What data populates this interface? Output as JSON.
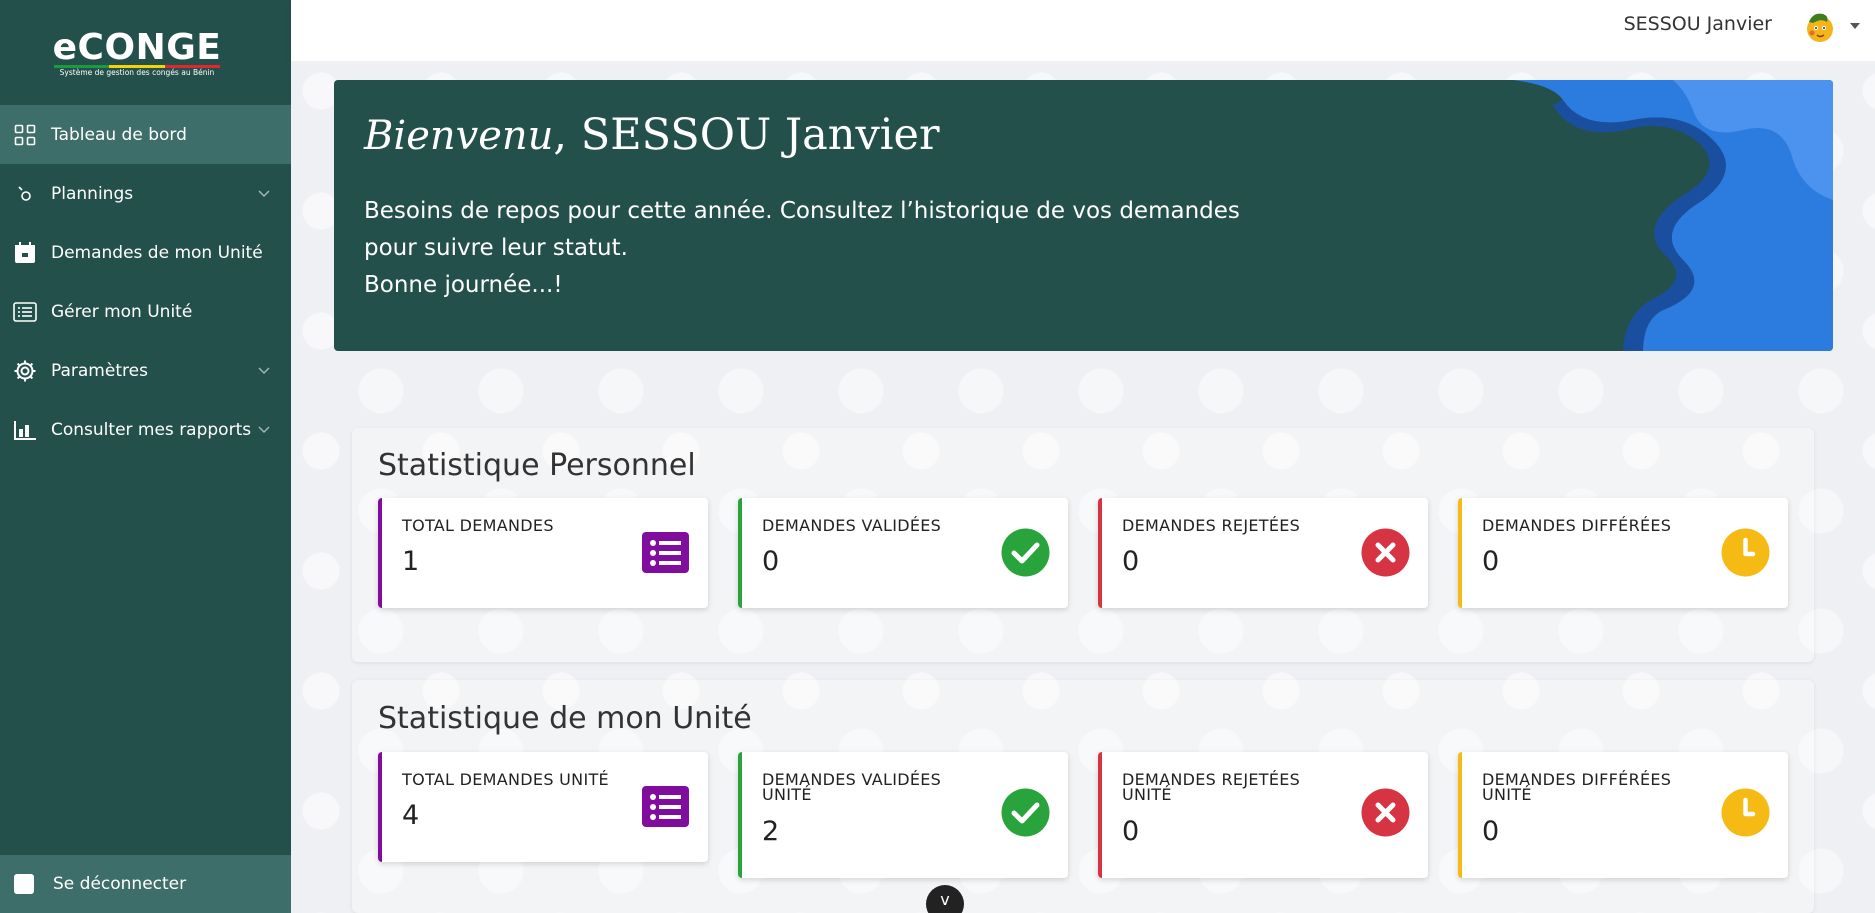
{
  "app": {
    "logo_text": "eCONGE",
    "logo_subtitle": "Système de gestion des congés au Bénin",
    "flag_colors": [
      "#1e9a3e",
      "#f5d20a",
      "#e3262e"
    ]
  },
  "sidebar": {
    "items": [
      {
        "label": "Tableau de bord",
        "icon": "dashboard-grid-icon",
        "active": true
      },
      {
        "label": "Plannings",
        "icon": "planning-icon",
        "has_chevron": true
      },
      {
        "label": "Demandes de mon Unité",
        "icon": "calendar-icon"
      },
      {
        "label": "Gérer mon Unité",
        "icon": "list-icon"
      },
      {
        "label": "Paramètres",
        "icon": "gear-icon",
        "has_chevron": true
      },
      {
        "label": "Consulter mes rapports",
        "icon": "bar-chart-icon",
        "has_chevron": true
      }
    ],
    "logout_label": "Se déconnecter"
  },
  "topbar": {
    "user_name": "SESSOU Janvier",
    "avatar_icon": "user-avatar-icon"
  },
  "banner": {
    "greeting_script": "Bienvenu",
    "greeting_name": ", SESSOU Janvier",
    "message_line1": "Besoins de repos pour cette année. Consultez l’historique de vos demandes",
    "message_line2": "pour suivre leur statut.",
    "message_line3": "Bonne journée...!"
  },
  "stats_personal": {
    "title": "Statistique Personnel",
    "cards": [
      {
        "label": "TOTAL DEMANDES",
        "value": "1",
        "color": "#800d9e",
        "icon": "list-icon"
      },
      {
        "label": "DEMANDES VALIDÉES",
        "value": "0",
        "color": "#29a33c",
        "icon": "check-circle-icon"
      },
      {
        "label": "DEMANDES REJETÉES",
        "value": "0",
        "color": "#d63343",
        "icon": "x-circle-icon"
      },
      {
        "label": "DEMANDES DIFFÉRÉES",
        "value": "0",
        "color": "#f5bb14",
        "icon": "clock-icon"
      }
    ]
  },
  "stats_unit": {
    "title": "Statistique de mon Unité",
    "cards": [
      {
        "label": "TOTAL DEMANDES UNITÉ",
        "value": "4",
        "color": "#800d9e",
        "icon": "list-icon"
      },
      {
        "label": "DEMANDES VALIDÉES UNITÉ",
        "value": "2",
        "color": "#29a33c",
        "icon": "check-circle-icon"
      },
      {
        "label": "DEMANDES REJETÉES UNITÉ",
        "value": "0",
        "color": "#d63343",
        "icon": "x-circle-icon"
      },
      {
        "label": "DEMANDES DIFFÉRÉES UNITÉ",
        "value": "0",
        "color": "#f5bb14",
        "icon": "clock-icon"
      }
    ]
  },
  "scroll_button_glyph": "v"
}
